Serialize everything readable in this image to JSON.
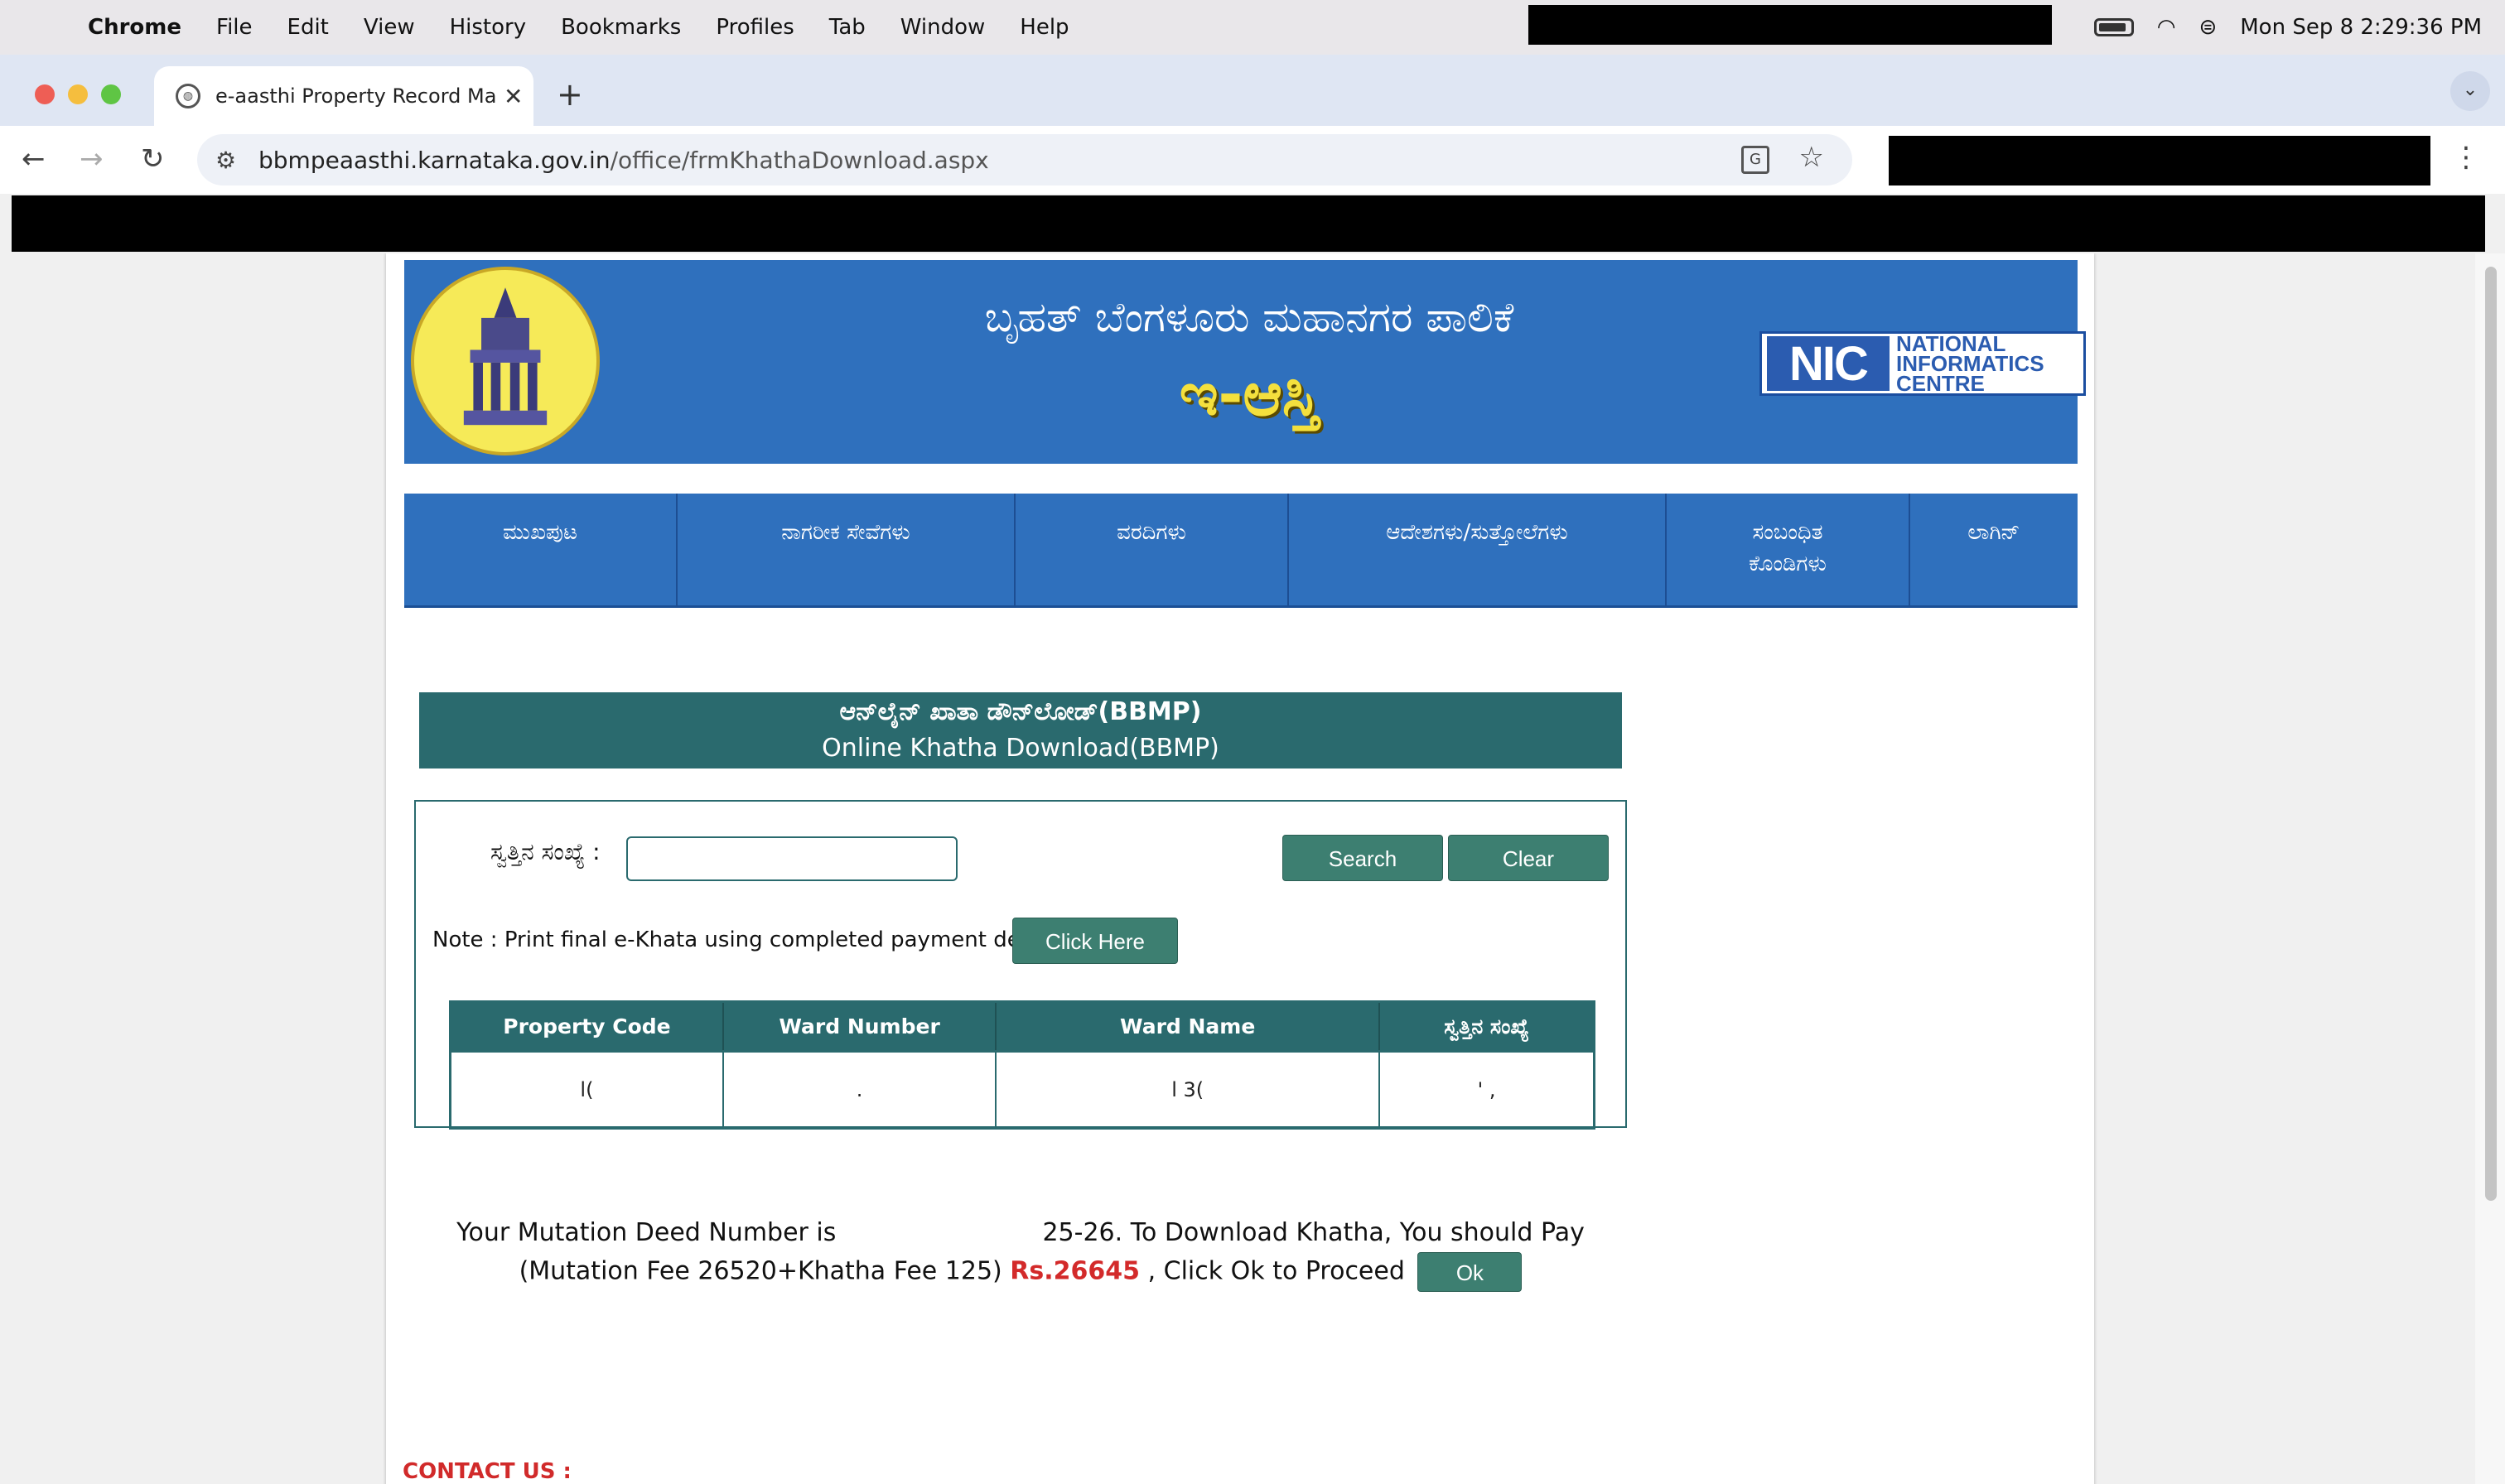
{
  "menubar": {
    "app": "Chrome",
    "items": [
      "File",
      "Edit",
      "View",
      "History",
      "Bookmarks",
      "Profiles",
      "Tab",
      "Window",
      "Help"
    ],
    "clock": "Mon Sep 8  2:29:36 PM"
  },
  "browser": {
    "tab_title": "e-aasthi Property Record Ma",
    "url_host": "bbmpeaasthi.karnataka.gov.in",
    "url_path": "/office/frmKhathaDownload.aspx"
  },
  "header": {
    "kannada_title": "ಬೃಹತ್ ಬೆಂಗಳೂರು ಮಹಾನಗರ ಪಾಲಿಕೆ",
    "eaasthi": "ಇ-ಆಸ್ತಿ",
    "nic_mark": "NIC",
    "nic_line1": "NATIONAL",
    "nic_line2": "INFORMATICS",
    "nic_line3": "CENTRE"
  },
  "nav": {
    "items": [
      "ಮುಖಪುಟ",
      "ನಾಗರೀಕ ಸೇವೆಗಳು",
      "ವರದಿಗಳು",
      "ಆದೇಶಗಳು/ಸುತ್ತೋಲೆಗಳು",
      "ಸಂಬಂಧಿತ ಕೊಂಡಿಗಳು",
      "ಲಾಗಿನ್"
    ]
  },
  "section": {
    "title_kannada": "ಆನ್‌ಲೈನ್ ಖಾತಾ ಡೌನ್‌ಲೋಡ್(BBMP)",
    "title_english": "Online Khatha Download(BBMP)"
  },
  "form": {
    "property_label": "ಸ್ವತ್ತಿನ ಸಂಖ್ಯೆ :",
    "property_value": "",
    "search_label": "Search",
    "clear_label": "Clear",
    "note": "Note : Print final e-Khata using completed payment details",
    "click_here_label": "Click Here"
  },
  "table": {
    "headers": [
      "Property Code",
      "Ward Number",
      "Ward Name",
      "ಸ್ವತ್ತಿನ ಸಂಖ್ಯೆ"
    ],
    "row": [
      "l(",
      ".",
      "l      3(",
      "' ,"
    ]
  },
  "mutation": {
    "prefix": "Your Mutation Deed Number is",
    "suffix": "25-26. To Download Khatha, You should Pay (Mutation Fee 26520+Khatha Fee 125)",
    "amount": "Rs.26645",
    "proceed": ", Click Ok to Proceed",
    "ok_label": "Ok"
  },
  "footer": {
    "contact": "CONTACT US :"
  },
  "colors": {
    "banner_blue": "#2f70bd",
    "teal": "#2a6a6e",
    "button_green": "#3d7f71",
    "amount_red": "#d32a2a"
  }
}
